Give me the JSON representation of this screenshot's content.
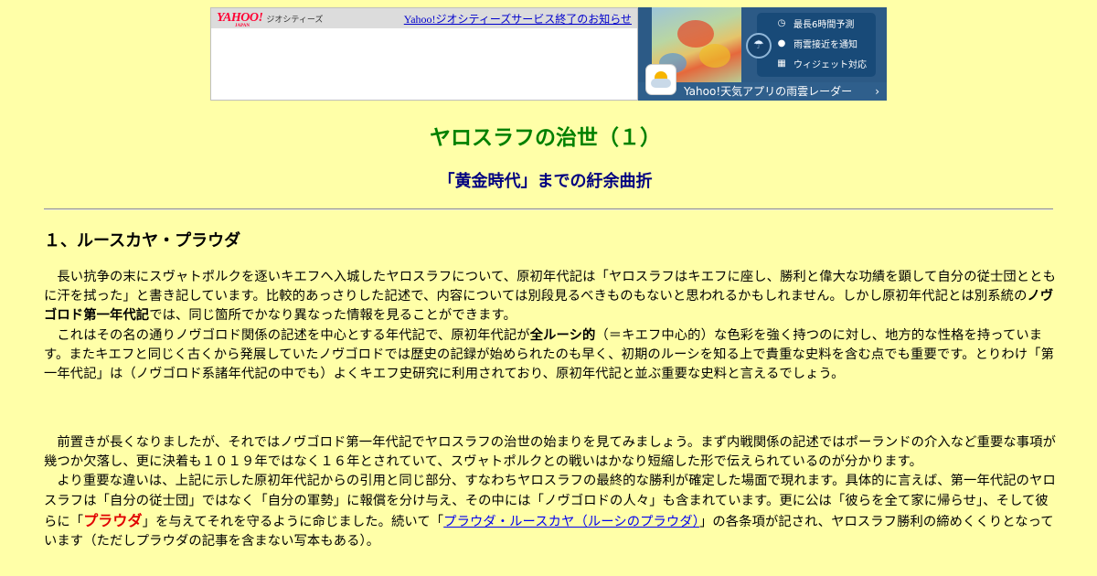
{
  "banner": {
    "logo": "YAHOO!",
    "logo_sub": "JAPAN",
    "geocities": "ジオシティーズ",
    "notice_link": "Yahoo!ジオシティーズサービス終了のお知らせ",
    "features": [
      {
        "icon": "clock-icon",
        "label": "最長6時間予測"
      },
      {
        "icon": "pin-icon",
        "label": "雨雲接近を通知"
      },
      {
        "icon": "widget-icon",
        "label": "ウィジェット対応"
      }
    ],
    "app_label": "Yahoo!天気アプリの雨雲レーダー",
    "chevron": "›"
  },
  "header": {
    "title": "ヤロスラフの治世（１）",
    "subtitle": "「黄金時代」までの紆余曲折"
  },
  "section": {
    "heading": "１、ルースカヤ・プラウダ"
  },
  "p1": {
    "a": "　長い抗争の末にスヴャトポルクを逐いキエフへ入城したヤロスラフについて、原初年代記は「ヤロスラフはキエフに座し、勝利と偉大な功績を顕して自分の従士団とともに汗を拭った」と書き記しています。比較的あっさりした記述で、内容については別段見るべきものもないと思われるかもしれません。しかし原初年代記とは別系統の",
    "b": "ノヴゴロド第一年代記",
    "c": "では、同じ箇所でかなり異なった情報を見ることができます。",
    "d": "　これはその名の通りノヴゴロド関係の記述を中心とする年代記で、原初年代記が",
    "e": "全ルーシ的",
    "f": "（＝キエフ中心的）な色彩を強く持つのに対し、地方的な性格を持っています。またキエフと同じく古くから発展していたノヴゴロドでは歴史の記録が始められたのも早く、初期のルーシを知る上で貴重な史料を含む点でも重要です。とりわけ「第一年代記」は（ノヴゴロド系諸年代記の中でも）よくキエフ史研究に利用されており、原初年代記と並ぶ重要な史料と言えるでしょう。"
  },
  "p2": {
    "a": "　前置きが長くなりましたが、それではノヴゴロド第一年代記でヤロスラフの治世の始まりを見てみましょう。まず内戦関係の記述ではポーランドの介入など重要な事項が幾つか欠落し、更に決着も１０１９年ではなく１６年とされていて、スヴャトポルクとの戦いはかなり短縮した形で伝えられているのが分かります。",
    "b": "　より重要な違いは、上記に示した原初年代記からの引用と同じ部分、すなわちヤロスラフの最終的な勝利が確定した場面で現れます。具体的に言えば、第一年代記のヤロスラフは「自分の従士団」ではなく「自分の軍勢」に報償を分け与え、その中には「ノヴゴロドの人々」も含まれています。更に公は「彼らを全て家に帰らせ」、そして彼らに「",
    "c": "プラウダ",
    "d": "」を与えてそれを守るように命じました。続いて「",
    "e": "プラウダ・ルースカヤ（ルーシのプラウダ）",
    "f": "」の各条項が記され、ヤロスラフ勝利の締めくくりとなっています（ただしプラウダの記事を含まない写本もある）。"
  }
}
